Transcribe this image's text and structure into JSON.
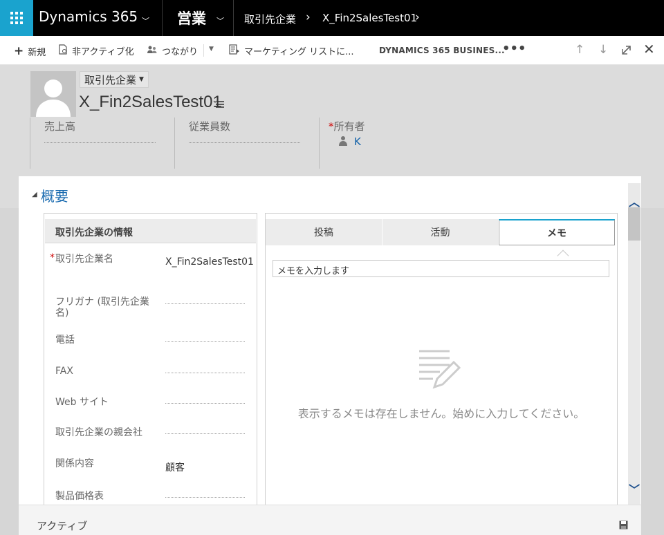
{
  "topbar": {
    "brand": "Dynamics 365",
    "module": "営業",
    "breadcrumb": "取引先企業",
    "record": "X_Fin2SalesTest01"
  },
  "commands": {
    "new": "新規",
    "deactivate": "非アクティブ化",
    "connect": "つながり",
    "marketing": "マーケティング リストに...",
    "app": "DYNAMICS 365 BUSINES..."
  },
  "header": {
    "entity_type": "取引先企業",
    "record_name": "X_Fin2SalesTest01",
    "revenue_label": "売上高",
    "employees_label": "従業員数",
    "owner_label": "所有者",
    "owner_value": "K"
  },
  "section": {
    "title": "概要"
  },
  "info": {
    "title": "取引先企業の情報",
    "fields": [
      {
        "label": "取引先企業名",
        "value": "X_Fin2SalesTest01",
        "required": true
      },
      {
        "label": "フリガナ (取引先企業名)",
        "value": ""
      },
      {
        "label": "電話",
        "value": ""
      },
      {
        "label": "FAX",
        "value": ""
      },
      {
        "label": "Web サイト",
        "value": ""
      },
      {
        "label": "取引先企業の親会社",
        "value": ""
      },
      {
        "label": "関係内容",
        "value": "顧客"
      },
      {
        "label": "製品価格表",
        "value": ""
      }
    ]
  },
  "tabs": {
    "posts": "投稿",
    "activities": "活動",
    "notes": "メモ",
    "active": "notes"
  },
  "notes": {
    "placeholder": "メモを入力します",
    "empty_message": "表示するメモは存在しません。始めに入力してください。"
  },
  "footer": {
    "status": "アクティブ"
  },
  "colors": {
    "waffle": "#1aa3ce",
    "link": "#1060a8",
    "section_title": "#1a6bb0"
  }
}
